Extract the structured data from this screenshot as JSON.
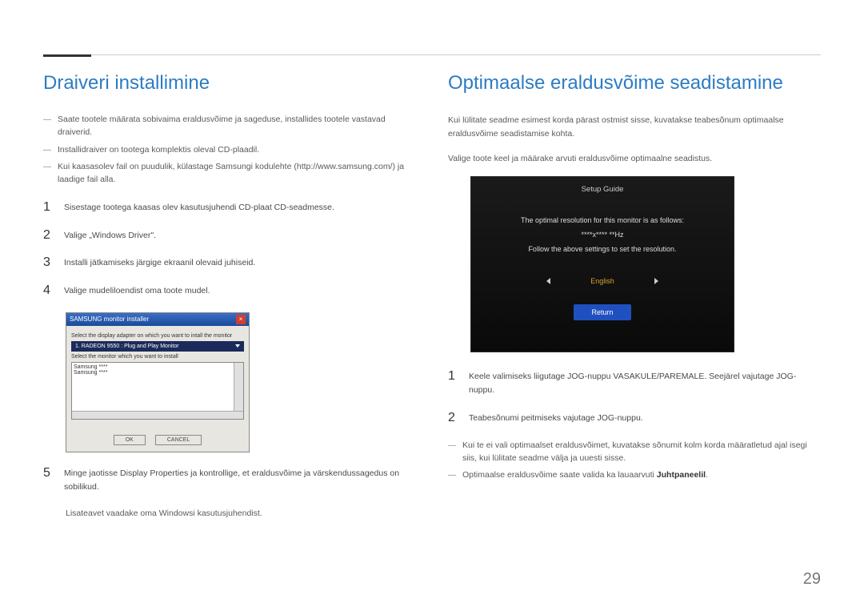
{
  "page_number": "29",
  "left": {
    "heading": "Draiveri installimine",
    "notes": [
      "Saate tootele määrata sobivaima eraldusvõime ja sageduse, installides tootele vastavad draiverid.",
      "Installidraiver on tootega komplektis oleval CD-plaadil.",
      "Kui kaasasolev fail on puudulik, külastage Samsungi kodulehte (http://www.samsung.com/) ja laadige fail alla."
    ],
    "steps": [
      "Sisestage tootega kaasas olev kasutusjuhendi CD-plaat CD-seadmesse.",
      "Valige „Windows Driver\".",
      "Installi jätkamiseks järgige ekraanil olevaid juhiseid.",
      "Valige mudeliloendist oma toote mudel."
    ],
    "installer": {
      "title": "SAMSUNG monitor installer",
      "label1": "Select the display adapter on which you want to intall the monitor",
      "dropdown": "1. RADEON 9550 : Plug and Play Monitor",
      "label2": "Select the monitor which you want to install",
      "list_items": [
        "Samsung ****",
        "Samsung ****"
      ],
      "ok": "OK",
      "cancel": "CANCEL"
    },
    "step5": "Minge jaotisse Display Properties ja kontrollige, et eraldusvõime ja värskendussagedus on sobilikud.",
    "extra": "Lisateavet vaadake oma Windowsi kasutusjuhendist."
  },
  "right": {
    "heading": "Optimaalse eraldusvõime seadistamine",
    "intro1": "Kui lülitate seadme esimest korda pärast ostmist sisse, kuvatakse teabesõnum optimaalse eraldusvõime seadistamise kohta.",
    "intro2": "Valige toote keel ja määrake arvuti eraldusvõime optimaalne seadistus.",
    "setup": {
      "title": "Setup Guide",
      "line1": "The optimal resolution for this monitor is as follows:",
      "resolution": "****x**** **Hz",
      "line2": "Follow the above settings to set the resolution.",
      "language": "English",
      "return": "Return"
    },
    "steps": [
      "Keele valimiseks liigutage JOG-nuppu VASAKULE/PAREMALE. Seejärel vajutage JOG-nuppu.",
      "Teabesõnumi peitmiseks vajutage JOG-nuppu."
    ],
    "notes": [
      "Kui te ei vali optimaalset eraldusvõimet, kuvatakse sõnumit kolm korda määratletud ajal isegi siis, kui lülitate seadme välja ja uuesti sisse."
    ],
    "note2_pre": "Optimaalse eraldusvõime saate valida ka lauaarvuti ",
    "note2_bold": "Juhtpaneelil",
    "note2_post": "."
  }
}
